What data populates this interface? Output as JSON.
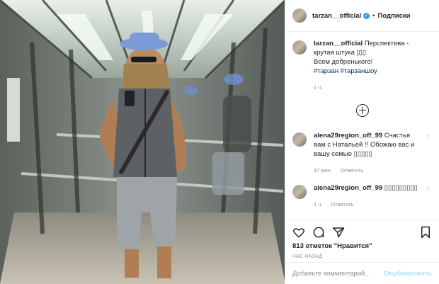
{
  "post": {
    "author": "tarzan__official",
    "header": {
      "separator": "•",
      "follow_label": "Подписки"
    },
    "caption": {
      "text_line1": "Перспектива -",
      "text_line2": "крутая штука )▯▯",
      "text_line3": "Всем добренького!",
      "hashtags": "#тарзан #тарзаншоу",
      "time": "1 ч."
    },
    "comments": [
      {
        "user": "alena29region_off_99",
        "text": "Счастья вам с Натальей !! Обожаю вас и вашу семью ▯▯▯▯▯",
        "time": "47 мин.",
        "reply": "Ответить"
      },
      {
        "user": "alena29region_off_99",
        "text": "▯▯▯▯▯▯▯▯▯",
        "time": "1 ч.",
        "reply": "Ответить"
      }
    ],
    "likes": "813 отметок \"Нравится\"",
    "timestamp": "ЧАС НАЗАД",
    "add_comment_placeholder": "Добавьте комментарий...",
    "publish_label": "Опубликовать"
  }
}
